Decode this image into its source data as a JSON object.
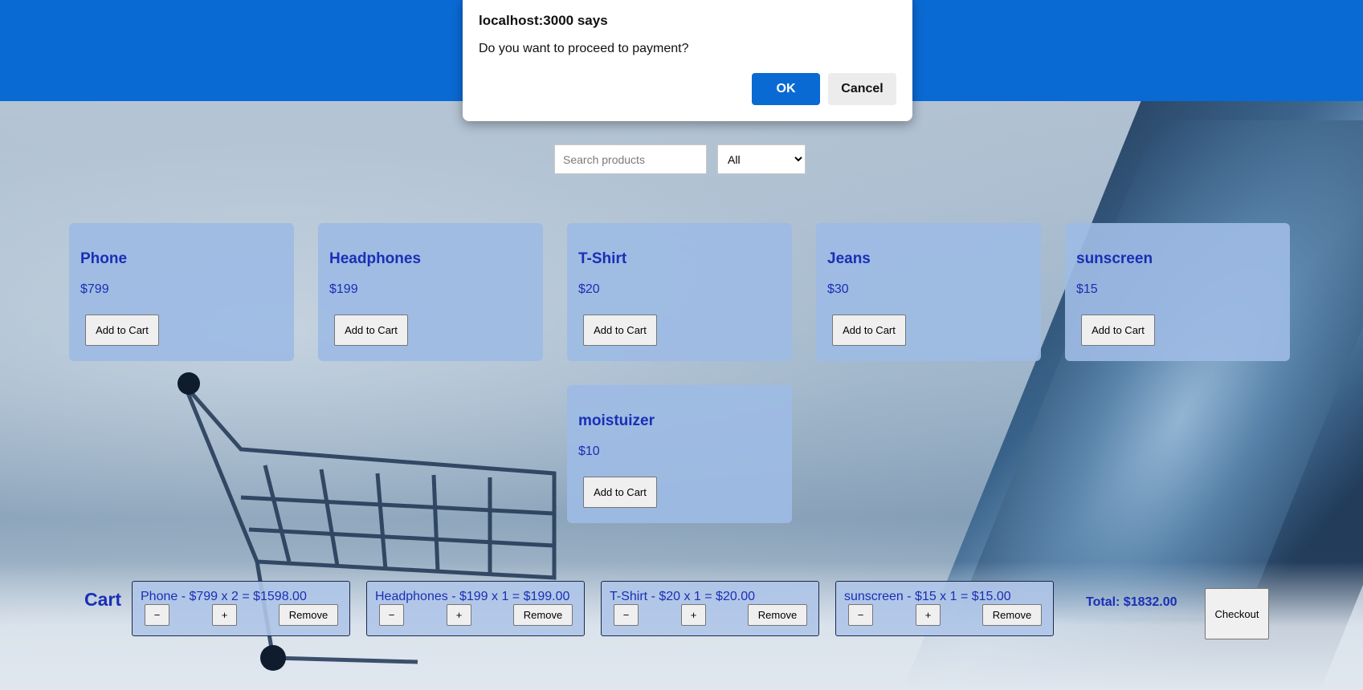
{
  "dialog": {
    "title": "localhost:3000 says",
    "message": "Do you want to proceed to payment?",
    "ok_label": "OK",
    "cancel_label": "Cancel"
  },
  "filters": {
    "search_placeholder": "Search products",
    "search_value": "",
    "category_selected": "All"
  },
  "products": [
    {
      "name": "Phone",
      "price": "$799",
      "button_label": "Add to Cart"
    },
    {
      "name": "Headphones",
      "price": "$199",
      "button_label": "Add to Cart"
    },
    {
      "name": "T-Shirt",
      "price": "$20",
      "button_label": "Add to Cart"
    },
    {
      "name": "Jeans",
      "price": "$30",
      "button_label": "Add to Cart"
    },
    {
      "name": "sunscreen",
      "price": "$15",
      "button_label": "Add to Cart"
    },
    {
      "name": "moistuizer",
      "price": "$10",
      "button_label": "Add to Cart"
    }
  ],
  "cart": {
    "title": "Cart",
    "items": [
      {
        "text": "Phone - $799 x 2 = $1598.00",
        "minus_label": "−",
        "plus_label": "+",
        "remove_label": "Remove"
      },
      {
        "text": "Headphones - $199 x 1 = $199.00",
        "minus_label": "−",
        "plus_label": "+",
        "remove_label": "Remove"
      },
      {
        "text": "T-Shirt - $20 x 1 = $20.00",
        "minus_label": "−",
        "plus_label": "+",
        "remove_label": "Remove"
      },
      {
        "text": "sunscreen - $15 x 1 = $15.00",
        "minus_label": "−",
        "plus_label": "+",
        "remove_label": "Remove"
      }
    ],
    "total": "Total: $1832.00",
    "checkout_label": "Checkout"
  },
  "colors": {
    "header": "#0a6ad4",
    "accent_text": "#1a2fb5",
    "card": "#9dbbe4"
  }
}
